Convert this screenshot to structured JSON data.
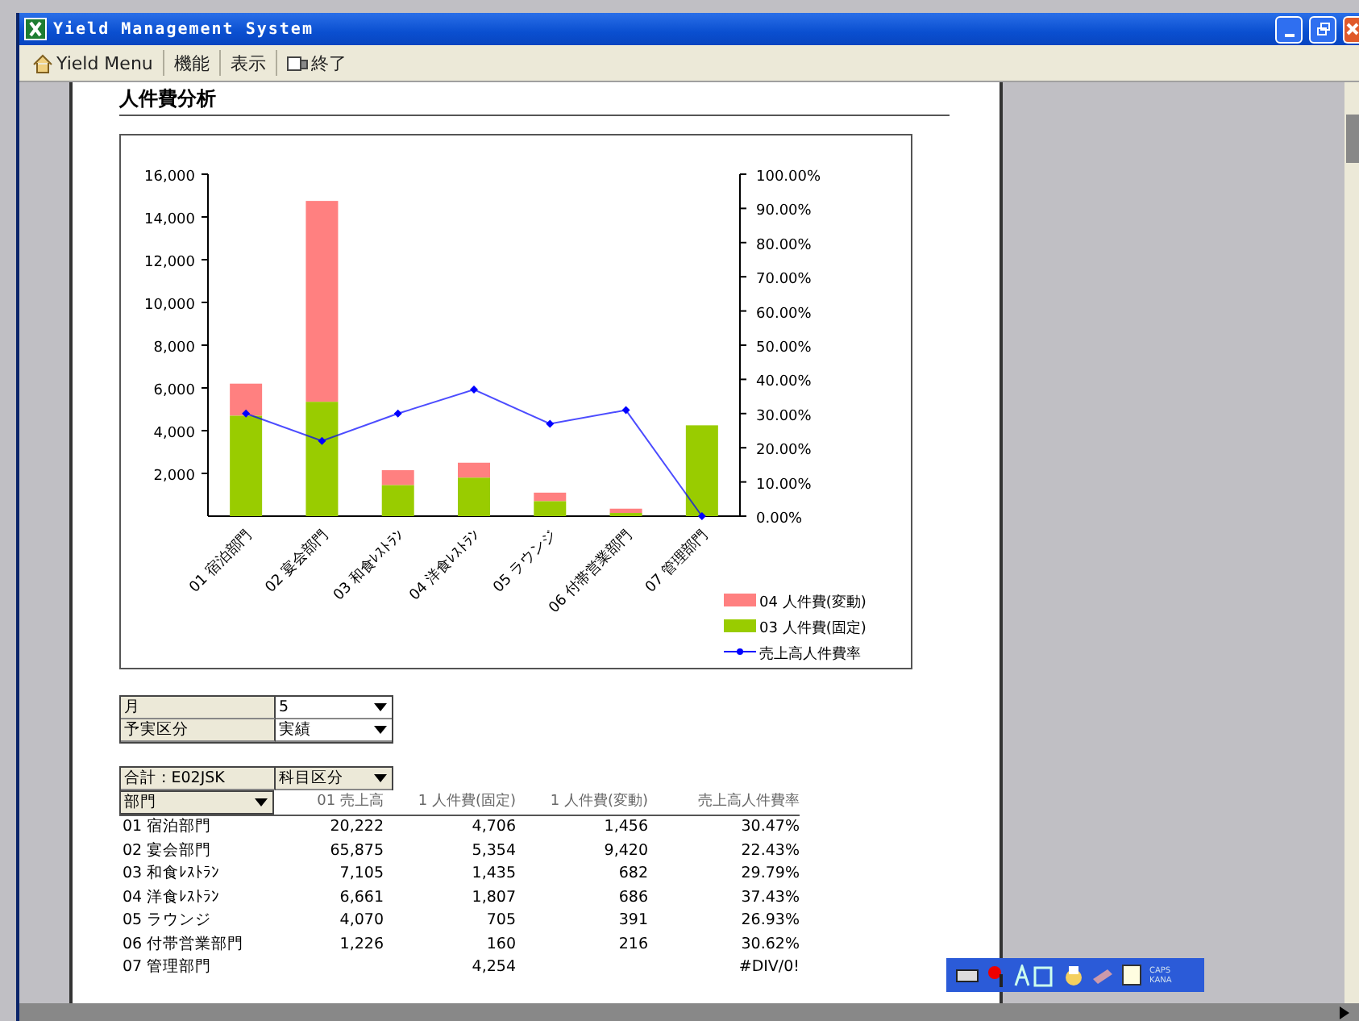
{
  "window": {
    "title": "Yield Management System"
  },
  "toolbar": [
    {
      "kind": "home",
      "label": "Yield Menu"
    },
    {
      "kind": "text",
      "label": "機能"
    },
    {
      "kind": "text",
      "label": "表示"
    },
    {
      "kind": "exit",
      "label": "終了"
    }
  ],
  "report_title": "人件費分析",
  "chart_data": {
    "type": "bar",
    "stacked": true,
    "categories": [
      "01 宿泊部門",
      "02 宴会部門",
      "03 和食ﾚｽﾄﾗﾝ",
      "04 洋食ﾚｽﾄﾗﾝ",
      "05 ラウンジ",
      "06 付帯営業部門",
      "07 管理部門"
    ],
    "series": [
      {
        "name": "04 人件費(変動)",
        "color": "#ff8080",
        "type": "bar",
        "values": [
          1500,
          9400,
          700,
          700,
          400,
          200,
          null
        ]
      },
      {
        "name": "03 人件費(固定)",
        "color": "#99cc00",
        "type": "bar",
        "values": [
          4700,
          5350,
          1450,
          1800,
          700,
          150,
          4250
        ]
      },
      {
        "name": "売上高人件費率",
        "color": "#0000ff",
        "type": "line",
        "axis": "y2",
        "marker": "diamond",
        "values": [
          30,
          22,
          30,
          37,
          27,
          31,
          0
        ]
      }
    ],
    "legend": true,
    "ylim": [
      0,
      16000
    ],
    "yticks": [
      {
        "value": 2000,
        "label": "2,000"
      },
      {
        "value": 4000,
        "label": "4,000"
      },
      {
        "value": 6000,
        "label": "6,000"
      },
      {
        "value": 8000,
        "label": "8,000"
      },
      {
        "value": 10000,
        "label": "10,000"
      },
      {
        "value": 12000,
        "label": "12,000"
      },
      {
        "value": 14000,
        "label": "14,000"
      },
      {
        "value": 16000,
        "label": "16,000"
      }
    ],
    "y2lim": [
      0,
      100
    ],
    "y2ticks": [
      {
        "value": 0,
        "label": "0.00%"
      },
      {
        "value": 10,
        "label": "10.00%"
      },
      {
        "value": 20,
        "label": "20.00%"
      },
      {
        "value": 30,
        "label": "30.00%"
      },
      {
        "value": 40,
        "label": "40.00%"
      },
      {
        "value": 50,
        "label": "50.00%"
      },
      {
        "value": 60,
        "label": "60.00%"
      },
      {
        "value": 70,
        "label": "70.00%"
      },
      {
        "value": 80,
        "label": "80.00%"
      },
      {
        "value": 90,
        "label": "90.00%"
      },
      {
        "value": 100,
        "label": "100.00%"
      }
    ]
  },
  "filters": [
    {
      "label": "月",
      "value": "5"
    },
    {
      "label": "予実区分",
      "value": "実績"
    }
  ],
  "pivot": {
    "data_field": "合計 : E02JSK",
    "column_field": "科目区分",
    "columns": [
      "部門",
      "01 売上高",
      "1 人件費(固定)",
      "1 人件費(変動)",
      "売上高人件費率"
    ],
    "rows": [
      [
        "01 宿泊部門",
        "20,222",
        "4,706",
        "1,456",
        "30.47%"
      ],
      [
        "02 宴会部門",
        "65,875",
        "5,354",
        "9,420",
        "22.43%"
      ],
      [
        "03 和食ﾚｽﾄﾗﾝ",
        "7,105",
        "1,435",
        "682",
        "29.79%"
      ],
      [
        "04 洋食ﾚｽﾄﾗﾝ",
        "6,661",
        "1,807",
        "686",
        "37.43%"
      ],
      [
        "05 ラウンジ",
        "4,070",
        "705",
        "391",
        "26.93%"
      ],
      [
        "06 付帯営業部門",
        "1,226",
        "160",
        "216",
        "30.62%"
      ],
      [
        "07 管理部門",
        "",
        "4,254",
        "",
        "#DIV/0!"
      ]
    ]
  },
  "ime_bar": {
    "caps": "CAPS",
    "kana": "KANA"
  }
}
